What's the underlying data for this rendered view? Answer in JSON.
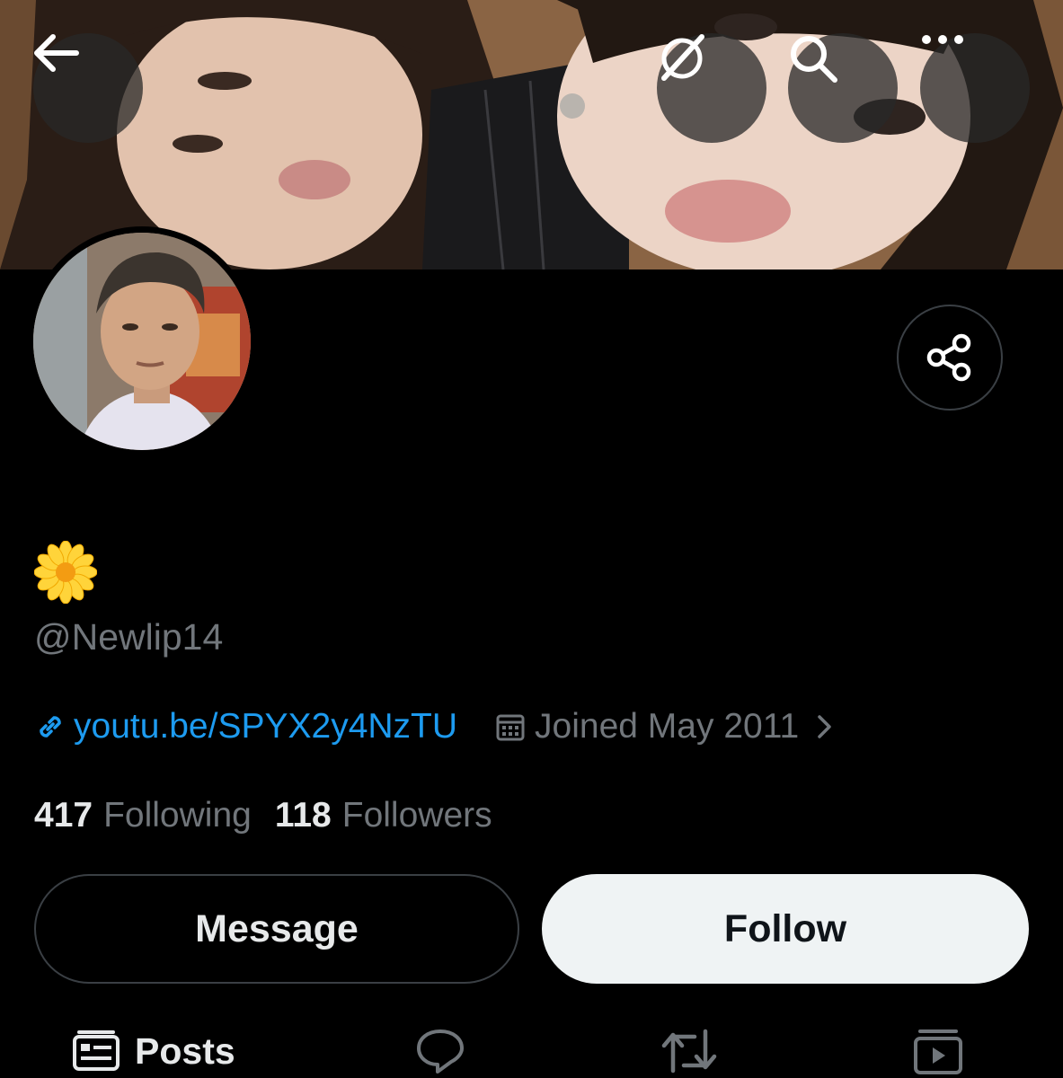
{
  "header": {
    "back_icon": "arrow-left-icon",
    "actions": [
      "grok-icon",
      "search-icon",
      "more-icon"
    ]
  },
  "profile": {
    "display_name_emoji": "sunflower",
    "handle": "@Newlip14",
    "link": "youtu.be/SPYX2y4NzTU",
    "joined": "Joined May 2011",
    "following_count": "417",
    "following_label": "Following",
    "followers_count": "118",
    "followers_label": "Followers"
  },
  "buttons": {
    "message": "Message",
    "follow": "Follow"
  },
  "tabs": {
    "posts": "Posts",
    "icons": [
      "posts-icon",
      "replies-icon",
      "reposts-icon",
      "media-icon"
    ]
  },
  "colors": {
    "background": "#000000",
    "link": "#1d9bf0",
    "muted": "#71767b",
    "follow_bg": "#eff3f4"
  }
}
